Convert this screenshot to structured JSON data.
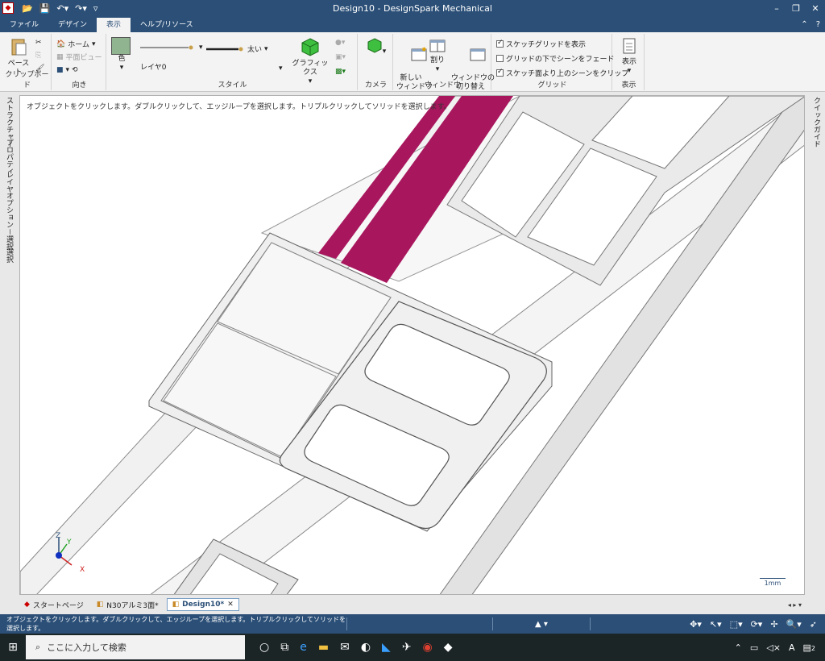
{
  "window": {
    "title": "Design10 - DesignSpark Mechanical",
    "minimize": "–",
    "restore": "❐",
    "close": "✕"
  },
  "tabs": [
    {
      "label": "ファイル"
    },
    {
      "label": "デザイン"
    },
    {
      "label": "表示"
    },
    {
      "label": "ヘルプ/リソース"
    }
  ],
  "ribbon": {
    "clipboard": {
      "paste": "ペースト",
      "label": "クリップボード"
    },
    "orientation": {
      "home": "ホーム",
      "plane_view": "平面ビュー",
      "label": "向き"
    },
    "style": {
      "color": "色",
      "layer": "レイヤ0",
      "line_weight": "太い",
      "graphics": "グラフィックス",
      "label": "スタイル",
      "swatch_color": "#8fb48f"
    },
    "camera": {
      "label": "カメラ"
    },
    "window": {
      "new_window": "新しい\nウィンドウ",
      "split": "割り",
      "switch": "ウィンドウの\n切り替え",
      "label": "ウィンドウ"
    },
    "grid": {
      "show_sketch_grid": "スケッチグリッドを表示",
      "fade_scene": "グリッドの下でシーンをフェード",
      "clip_scene": "スケッチ面より上のシーンをクリップ",
      "label": "グリッド",
      "checked": [
        true,
        false,
        true
      ]
    },
    "display": {
      "show": "表示",
      "label": "表示"
    }
  },
  "left_panels": [
    "ストラクチャー",
    "プロパティ",
    "レイヤ",
    "オプション－選択",
    "選択"
  ],
  "right_panel": "クイックガイド",
  "viewport": {
    "hint": "オブジェクトをクリックします。ダブルクリックして、エッジループを選択します。トリプルクリックしてソリッドを選択します。",
    "scale_label": "1mm",
    "axis": {
      "x": "X",
      "y": "Y",
      "z": "Z"
    },
    "accent_color": "#a8175e"
  },
  "doc_tabs": [
    {
      "label": "スタートページ",
      "active": false
    },
    {
      "label": "N30アルミ3面*",
      "active": false
    },
    {
      "label": "Design10*",
      "active": true
    }
  ],
  "status": {
    "message": "オブジェクトをクリックします。ダブルクリックして、エッジループを選択します。トリプルクリックしてソリッドを選択します。"
  },
  "taskbar": {
    "search_placeholder": "ここに入力して検索",
    "ime": "A",
    "notifications": "2"
  }
}
